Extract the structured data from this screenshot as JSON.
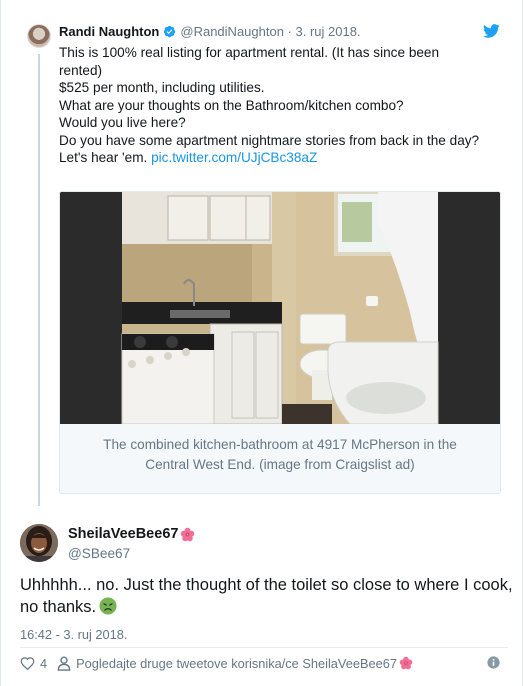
{
  "quoted_tweet": {
    "author_name": "Randi Naughton",
    "handle_and_date": "@RandiNaughton · 3. ruj 2018.",
    "lines": [
      "This is 100% real listing for apartment rental.  (It has since been",
      "rented)",
      "$525 per month, including utilities.",
      "What are your thoughts on the Bathroom/kitchen combo?",
      "Would you live here?",
      "Do you have some apartment nightmare stories from back in the day?"
    ],
    "last_line_prefix": "Let's hear 'em.",
    "link_text": "pic.twitter.com/UJjCBc38aZ",
    "caption_line1": "The combined kitchen-bathroom at 4917 McPherson in the",
    "caption_line2": "Central West End. (image from Craigslist ad)"
  },
  "reply_tweet": {
    "display_name": "SheilaVeeBee67",
    "handle": "@SBee67",
    "text_line1": "Uhhhhh... no. Just the thought of the toilet so close to where I cook,",
    "text_line2": "no thanks.",
    "timestamp": "16:42 - 3. ruj 2018.",
    "like_count": "4",
    "similar_accounts_label": "Pogledajte druge tweetove korisnika/ce SheilaVeeBee67"
  },
  "colors": {
    "link_blue": "#1b95e0",
    "secondary_text": "#657786",
    "primary_text": "#14171a"
  },
  "icons": [
    "verified-badge-icon",
    "twitter-bird-icon",
    "hibiscus-emoji-icon",
    "nauseated-face-emoji-icon",
    "heart-icon",
    "person-icon",
    "info-icon"
  ]
}
